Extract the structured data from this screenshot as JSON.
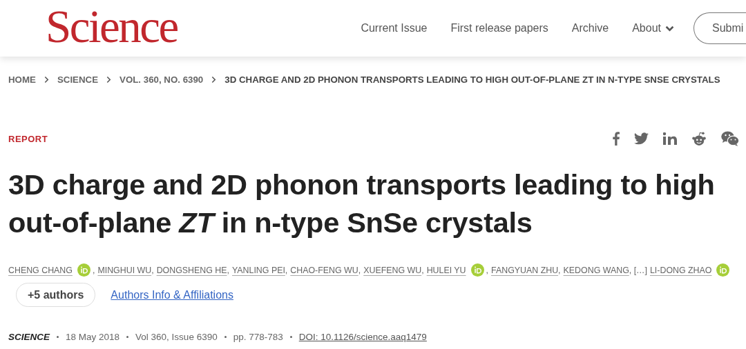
{
  "header": {
    "logo": "Science",
    "nav": [
      {
        "label": "Current Issue",
        "dropdown": false
      },
      {
        "label": "First release papers",
        "dropdown": false
      },
      {
        "label": "Archive",
        "dropdown": false
      },
      {
        "label": "About",
        "dropdown": true
      }
    ],
    "submit_button": "Submi"
  },
  "breadcrumb": [
    "HOME",
    "SCIENCE",
    "VOL. 360, NO. 6390",
    "3D CHARGE AND 2D PHONON TRANSPORTS LEADING TO HIGH OUT-OF-PLANE ZT IN N-TYPE SNSE CRYSTALS"
  ],
  "article": {
    "type": "REPORT",
    "share": [
      {
        "kind": "facebook"
      },
      {
        "kind": "twitter"
      },
      {
        "kind": "linkedin"
      },
      {
        "kind": "reddit"
      },
      {
        "kind": "wechat"
      }
    ],
    "title": "3D charge and 2D phonon transports leading to high out-of-plane *ZT* in n-type SnSe crystals",
    "authors": [
      {
        "name": "CHENG CHANG",
        "orcid": true,
        "after": ","
      },
      {
        "name": "MINGHUI WU",
        "orcid": false,
        "after": ","
      },
      {
        "name": "DONGSHENG HE",
        "orcid": false,
        "after": ","
      },
      {
        "name": "YANLING PEI",
        "orcid": false,
        "after": ","
      },
      {
        "name": "CHAO-FENG WU",
        "orcid": false,
        "after": ","
      },
      {
        "name": "XUEFENG WU",
        "orcid": false,
        "after": ","
      },
      {
        "name": "HULEI YU",
        "orcid": true,
        "after": ","
      },
      {
        "name": "FANGYUAN ZHU",
        "orcid": false,
        "after": ","
      },
      {
        "name": "KEDONG WANG",
        "orcid": false,
        "after": ", […]"
      },
      {
        "name": "LI-DONG ZHAO",
        "orcid": true
      }
    ],
    "more_authors_button": "+5 authors",
    "affiliations_link": "Authors Info & Affiliations",
    "meta": {
      "journal": "SCIENCE",
      "date": "18 May 2018",
      "volume": "Vol 360, Issue 6390",
      "pages": "pp. 778-783",
      "doi": "DOI: 10.1126/science.aaq1479"
    }
  }
}
